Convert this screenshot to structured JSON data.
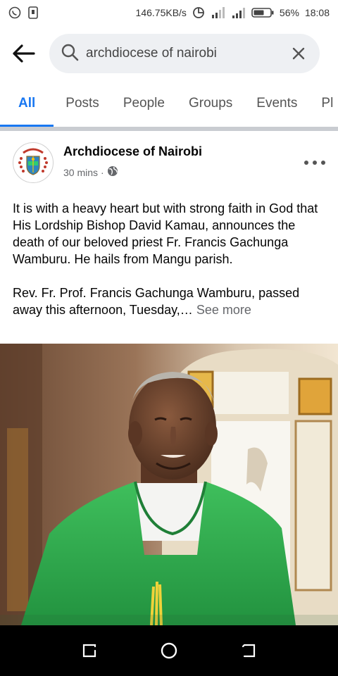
{
  "status_bar": {
    "network_speed": "146.75KB/s",
    "battery": "56%",
    "time": "18:08"
  },
  "search": {
    "query": "archdiocese of nairobi"
  },
  "tabs": [
    {
      "label": "All",
      "active": true
    },
    {
      "label": "Posts",
      "active": false
    },
    {
      "label": "People",
      "active": false
    },
    {
      "label": "Groups",
      "active": false
    },
    {
      "label": "Events",
      "active": false
    },
    {
      "label": "Pl",
      "active": false
    }
  ],
  "post": {
    "page_name": "Archdiocese of Nairobi",
    "time": "30 mins",
    "separator": "·",
    "paragraph_1": "It is with a heavy heart but with strong faith in God that His Lordship Bishop David Kamau, announces the death of our beloved priest Fr. Francis Gachunga Wamburu. He hails from Mangu parish.",
    "paragraph_2": "Rev.  Fr. Prof. Francis Gachunga Wamburu, passed away this afternoon, Tuesday,…",
    "see_more": "See more"
  },
  "colors": {
    "accent": "#1877f2",
    "vestment_green": "#2fa84f"
  }
}
